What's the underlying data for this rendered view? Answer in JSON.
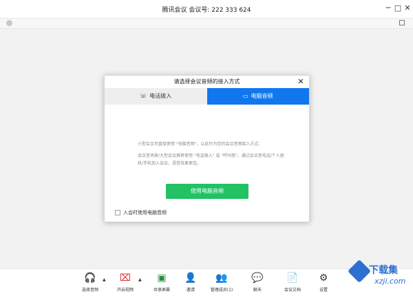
{
  "window": {
    "title": "腾讯会议 会议号: 222 333 624",
    "min_icon": "─",
    "max_icon": "□",
    "close_icon": "✕"
  },
  "dialog": {
    "title": "请选择会议音频的接入方式",
    "close_icon": "✕",
    "tabs": [
      {
        "label": "电话拨入",
        "icon": "☏",
        "active": false
      },
      {
        "label": "电脑音频",
        "icon": "▭",
        "active": true
      }
    ],
    "desc_line1": "小型会议可直接使用 \"电脑音频\"，以此作为您的会议音频接入方式;",
    "desc_line2": "会议室场景/大型会议推荐使用 \"电话拨入\" 或 \"呼叫我\"，通过会议室电话/个人座机/手机加入会议，语音效果更佳。",
    "use_button": "使用电脑音频",
    "checkbox_label": "入会时使用电脑音频"
  },
  "toolbar": {
    "items": [
      {
        "label": "选择音频",
        "icon": "🎧"
      },
      {
        "label": "开启视频",
        "icon": "⌧"
      },
      {
        "label": "共享屏幕",
        "icon": "▣"
      },
      {
        "label": "邀请",
        "icon": "👤"
      },
      {
        "label": "管理成员(1)",
        "icon": "👥"
      },
      {
        "label": "聊天",
        "icon": "💬"
      },
      {
        "label": "会议文档",
        "icon": "📄"
      },
      {
        "label": "设置",
        "icon": "⚙"
      }
    ],
    "caret": "▲"
  },
  "watermark": {
    "text": "下载集",
    "sub": "xzji.com"
  },
  "colors": {
    "accent_blue": "#1177ee",
    "green_button": "#21c164"
  }
}
